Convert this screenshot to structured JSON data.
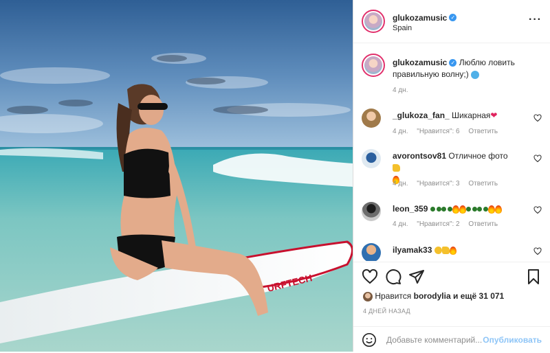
{
  "post": {
    "author": "glukozamusic",
    "location": "Spain",
    "more_icon": "more-horizontal-icon",
    "caption": {
      "username": "glukozamusic",
      "text": "Люблю ловить правильную волну;)",
      "emoji": "wave-emoji",
      "time": "4 дн."
    }
  },
  "comments": [
    {
      "username": "_glukoza_fan_",
      "text": "Шикарная",
      "emoji": "heart-emoji",
      "time": "4 дн.",
      "likes": "\"Нравится\": 6",
      "reply": "Ответить"
    },
    {
      "username": "avorontsov81",
      "text": "Отличное фото",
      "emoji": "thumbs-up-fire-emoji",
      "time": "4 дн.",
      "likes": "\"Нравится\": 3",
      "reply": "Ответить"
    },
    {
      "username": "leon_359",
      "text": "",
      "emoji": "sunglasses-fire-emoji",
      "time": "4 дн.",
      "likes": "\"Нравится\": 2",
      "reply": "Ответить"
    },
    {
      "username": "ilyamak33",
      "text": "",
      "emoji": "smile-thumb-fire-emoji",
      "time": "",
      "likes": "",
      "reply": ""
    }
  ],
  "actions": {
    "like_icon": "heart-icon",
    "comment_icon": "comment-icon",
    "share_icon": "share-icon",
    "save_icon": "bookmark-icon"
  },
  "likes": {
    "prefix": "Нравится",
    "user": "borodylia",
    "suffix": "и ещё 31 071"
  },
  "posted": "4 ДНЕЙ НАЗАД",
  "add_comment": {
    "emoji_icon": "smile-icon",
    "placeholder": "Добавьте комментарий...",
    "publish": "Опубликовать"
  },
  "colors": {
    "accent": "#3897f0",
    "publish_disabled": "#8ec5f7",
    "muted": "#8e8e8e"
  }
}
